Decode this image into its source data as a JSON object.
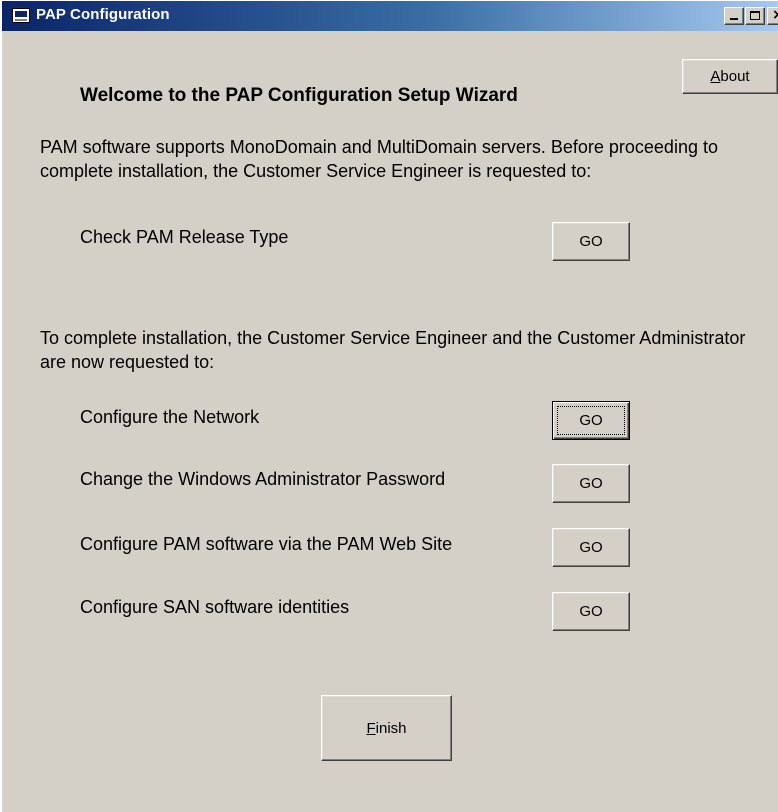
{
  "window": {
    "title": "PAP Configuration",
    "controls": {
      "minimize": "_",
      "maximize": "□",
      "close": "×"
    }
  },
  "about_button": {
    "prefix": "",
    "mnemonic": "A",
    "rest": "bout"
  },
  "heading": "Welcome to the PAP Configuration Setup Wizard",
  "intro_text": "PAM software supports MonoDomain and MultiDomain servers. Before proceeding to complete installation, the Customer Service Engineer is requested to:",
  "release_task": {
    "label": "Check PAM Release Type",
    "button": "GO"
  },
  "completion_text": "To complete installation, the Customer Service Engineer and the Customer Administrator are now requested to:",
  "tasks": [
    {
      "label": "Configure the Network",
      "button": "GO"
    },
    {
      "label": "Change the Windows Administrator Password",
      "button": "GO"
    },
    {
      "label": "Configure PAM software via the PAM Web Site",
      "button": "GO"
    },
    {
      "label": "Configure SAN software identities",
      "button": "GO"
    }
  ],
  "finish_button": {
    "mnemonic": "F",
    "rest": "inish"
  },
  "colors": {
    "titlebar_start": "#0a246a",
    "titlebar_end": "#a6caf0",
    "face": "#d4d0c8"
  }
}
